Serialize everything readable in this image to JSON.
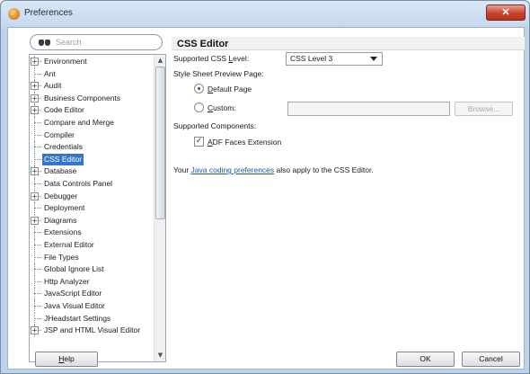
{
  "window": {
    "title": "Preferences",
    "close_glyph": "✕"
  },
  "search": {
    "placeholder": "Search"
  },
  "tree": {
    "items": [
      {
        "label": "Environment",
        "expandable": true
      },
      {
        "label": "Ant",
        "expandable": false
      },
      {
        "label": "Audit",
        "expandable": true
      },
      {
        "label": "Business Components",
        "expandable": true
      },
      {
        "label": "Code Editor",
        "expandable": true
      },
      {
        "label": "Compare and Merge",
        "expandable": false
      },
      {
        "label": "Compiler",
        "expandable": false
      },
      {
        "label": "Credentials",
        "expandable": false
      },
      {
        "label": "CSS Editor",
        "expandable": false,
        "selected": true
      },
      {
        "label": "Database",
        "expandable": true
      },
      {
        "label": "Data Controls Panel",
        "expandable": false
      },
      {
        "label": "Debugger",
        "expandable": true
      },
      {
        "label": "Deployment",
        "expandable": false
      },
      {
        "label": "Diagrams",
        "expandable": true
      },
      {
        "label": "Extensions",
        "expandable": false
      },
      {
        "label": "External Editor",
        "expandable": false
      },
      {
        "label": "File Types",
        "expandable": false
      },
      {
        "label": "Global Ignore List",
        "expandable": false
      },
      {
        "label": "Http Analyzer",
        "expandable": false
      },
      {
        "label": "JavaScript Editor",
        "expandable": false
      },
      {
        "label": "Java Visual Editor",
        "expandable": false
      },
      {
        "label": "JHeadstart Settings",
        "expandable": false
      },
      {
        "label": "JSP and HTML Visual Editor",
        "expandable": true
      }
    ]
  },
  "panel": {
    "title": "CSS Editor",
    "css_level": {
      "label_pre": "Supported CSS ",
      "label_key": "L",
      "label_post": "evel:",
      "value": "CSS Level 3"
    },
    "preview_label": "Style Sheet Preview Page:",
    "radio_default": {
      "key": "D",
      "rest": "efault Page",
      "checked": true
    },
    "radio_custom": {
      "key": "C",
      "rest": "ustom:",
      "checked": false
    },
    "custom_value": "",
    "browse_label": "Browse...",
    "components_label": "Supported Components:",
    "adf": {
      "key": "A",
      "rest": "DF Faces Extension",
      "checked": true
    },
    "note": {
      "pre": "Your ",
      "link": "Java coding preferences",
      "post": " also apply to the CSS Editor."
    }
  },
  "buttons": {
    "help_key": "H",
    "help_rest": "elp",
    "ok": "OK",
    "cancel": "Cancel"
  }
}
